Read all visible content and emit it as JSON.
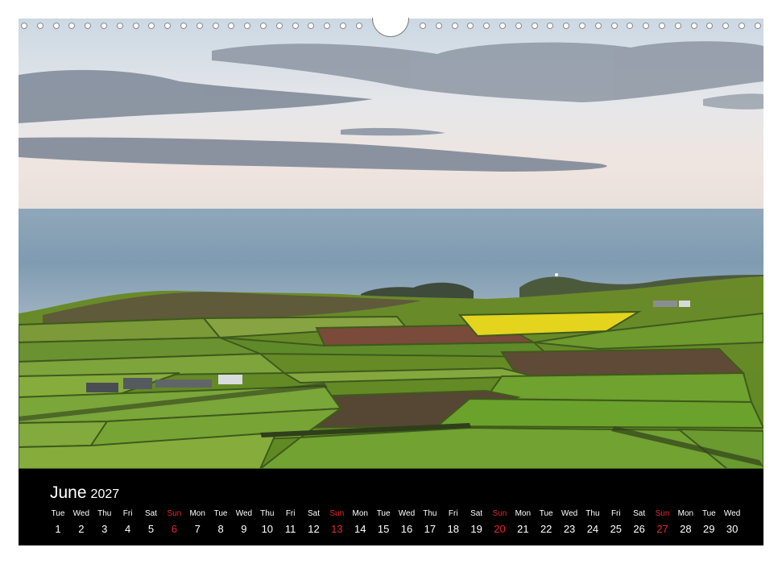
{
  "calendar": {
    "month": "June",
    "year": "2027",
    "days": [
      {
        "name": "Tue",
        "date": "1",
        "sunday": false
      },
      {
        "name": "Wed",
        "date": "2",
        "sunday": false
      },
      {
        "name": "Thu",
        "date": "3",
        "sunday": false
      },
      {
        "name": "Fri",
        "date": "4",
        "sunday": false
      },
      {
        "name": "Sat",
        "date": "5",
        "sunday": false
      },
      {
        "name": "Sun",
        "date": "6",
        "sunday": true
      },
      {
        "name": "Mon",
        "date": "7",
        "sunday": false
      },
      {
        "name": "Tue",
        "date": "8",
        "sunday": false
      },
      {
        "name": "Wed",
        "date": "9",
        "sunday": false
      },
      {
        "name": "Thu",
        "date": "10",
        "sunday": false
      },
      {
        "name": "Fri",
        "date": "11",
        "sunday": false
      },
      {
        "name": "Sat",
        "date": "12",
        "sunday": false
      },
      {
        "name": "Sun",
        "date": "13",
        "sunday": true
      },
      {
        "name": "Mon",
        "date": "14",
        "sunday": false
      },
      {
        "name": "Tue",
        "date": "15",
        "sunday": false
      },
      {
        "name": "Wed",
        "date": "16",
        "sunday": false
      },
      {
        "name": "Thu",
        "date": "17",
        "sunday": false
      },
      {
        "name": "Fri",
        "date": "18",
        "sunday": false
      },
      {
        "name": "Sat",
        "date": "19",
        "sunday": false
      },
      {
        "name": "Sun",
        "date": "20",
        "sunday": true
      },
      {
        "name": "Mon",
        "date": "21",
        "sunday": false
      },
      {
        "name": "Tue",
        "date": "22",
        "sunday": false
      },
      {
        "name": "Wed",
        "date": "23",
        "sunday": false
      },
      {
        "name": "Thu",
        "date": "24",
        "sunday": false
      },
      {
        "name": "Fri",
        "date": "25",
        "sunday": false
      },
      {
        "name": "Sat",
        "date": "26",
        "sunday": false
      },
      {
        "name": "Sun",
        "date": "27",
        "sunday": true
      },
      {
        "name": "Mon",
        "date": "28",
        "sunday": false
      },
      {
        "name": "Tue",
        "date": "29",
        "sunday": false
      },
      {
        "name": "Wed",
        "date": "30",
        "sunday": false
      }
    ]
  },
  "colors": {
    "sunday": "#e8262b",
    "bar_background": "#000000",
    "text": "#ffffff"
  }
}
